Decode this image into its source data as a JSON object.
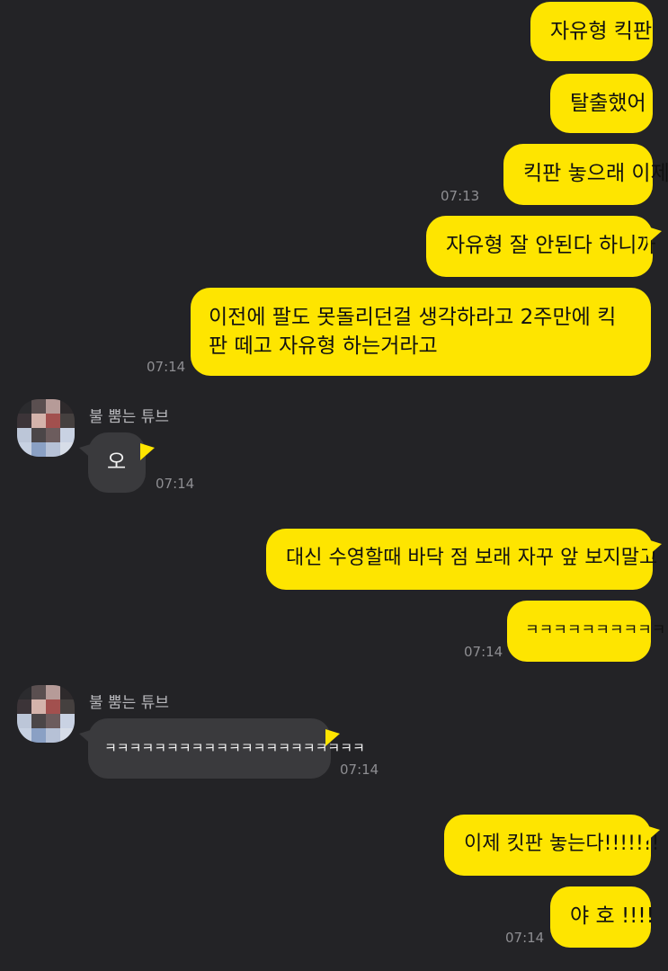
{
  "messages": {
    "m1": {
      "text": "자유형 킥판"
    },
    "m2": {
      "text": "탈출했어"
    },
    "m3": {
      "text": "킥판 놓으래 이제",
      "time": "07:13"
    },
    "m4": {
      "text": "자유형 잘 안된다 하니까"
    },
    "m5": {
      "text": "이전에 팔도 못돌리던걸 생각하라고 2주만에 킥판 떼고 자유형 하는거라고",
      "time": "07:14"
    },
    "m6": {
      "sender": "불 뿜는 튜브",
      "text": "오",
      "time": "07:14"
    },
    "m7": {
      "text": "대신 수영할때 바닥 점 보래 자꾸 앞 보지말고"
    },
    "m8": {
      "text": "ㅋㅋㅋㅋㅋㅋㅋㅋㅋㅋㅋ",
      "time": "07:14"
    },
    "m9": {
      "sender": "불 뿜는 튜브",
      "text": "ㅋㅋㅋㅋㅋㅋㅋㅋㅋㅋㅋㅋㅋㅋㅋㅋㅋㅋㅋㅋㅋ",
      "time": "07:14"
    },
    "m10": {
      "text": "이제 킷판 놓는다!!!!!!!"
    },
    "m11": {
      "text": "야 호 !!!!",
      "time": "07:14"
    }
  },
  "colors": {
    "background": "#232326",
    "outgoing_bubble": "#fee500",
    "incoming_bubble": "#3a3a3d"
  },
  "avatar": {
    "icon": "pixelated-profile-photo"
  }
}
